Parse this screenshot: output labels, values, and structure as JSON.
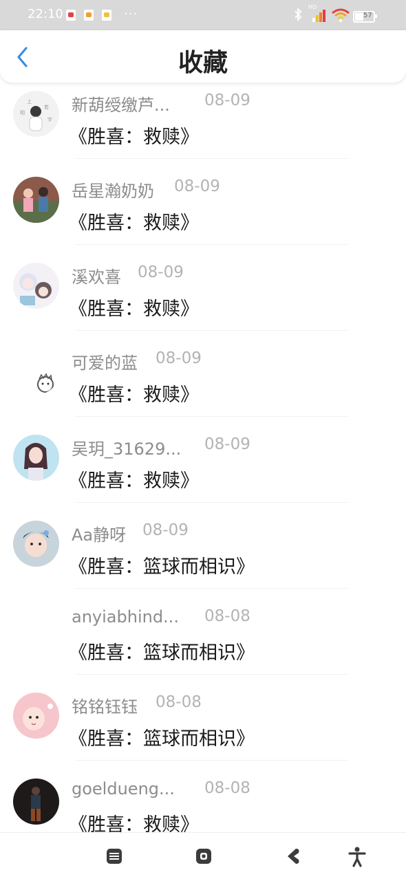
{
  "status_bar": {
    "time": "22:10",
    "more": "···",
    "battery": "57",
    "network": "HD",
    "icons": [
      "red-app-icon",
      "orange-app-icon",
      "yellow-app-icon",
      "bluetooth-icon",
      "signal-icon",
      "wifi-icon",
      "battery-icon"
    ]
  },
  "header": {
    "title": "收藏",
    "back_icon": "chevron-left-icon"
  },
  "accent": "#3a8ee6",
  "items": [
    {
      "user": "新葫绶缴芦...",
      "date": "08-09",
      "title": "《胜喜：救赎》"
    },
    {
      "user": "岳星瀚奶奶",
      "date": "08-09",
      "title": "《胜喜：救赎》"
    },
    {
      "user": "溪欢喜",
      "date": "08-09",
      "title": "《胜喜：救赎》"
    },
    {
      "user": "可爱的蓝",
      "date": "08-09",
      "title": "《胜喜：救赎》"
    },
    {
      "user": "吴玥_31629...",
      "date": "08-09",
      "title": "《胜喜：救赎》"
    },
    {
      "user": "Aa静呀",
      "date": "08-09",
      "title": "《胜喜：篮球而相识》"
    },
    {
      "user": "anyiabhind...",
      "date": "08-08",
      "title": "《胜喜：篮球而相识》"
    },
    {
      "user": "铭铭钰钰",
      "date": "08-08",
      "title": "《胜喜：篮球而相识》"
    },
    {
      "user": "goeldueng...",
      "date": "08-08",
      "title": "《胜喜：救赎》"
    }
  ],
  "nav": {
    "icons": [
      "menu-icon",
      "home-icon",
      "back-icon",
      "accessibility-icon"
    ]
  }
}
